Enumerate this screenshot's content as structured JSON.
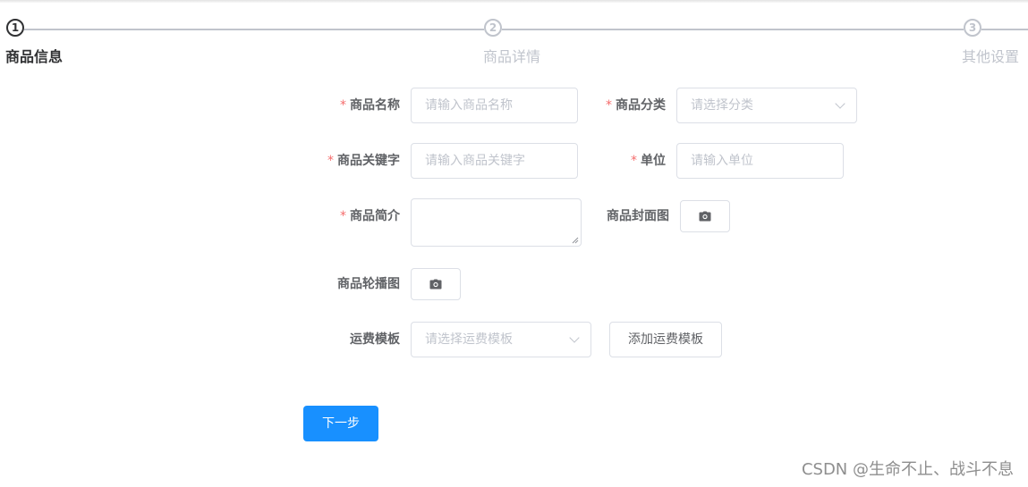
{
  "steps": [
    {
      "number": "1",
      "title": "商品信息",
      "status": "active"
    },
    {
      "number": "2",
      "title": "商品详情",
      "status": "wait"
    },
    {
      "number": "3",
      "title": "其他设置",
      "status": "wait"
    }
  ],
  "form": {
    "required_mark": "*",
    "name": {
      "label": "商品名称",
      "placeholder": "请输入商品名称",
      "value": ""
    },
    "category": {
      "label": "商品分类",
      "placeholder": "请选择分类",
      "value": ""
    },
    "keywords": {
      "label": "商品关键字",
      "placeholder": "请输入商品关键字",
      "value": ""
    },
    "unit": {
      "label": "单位",
      "placeholder": "请输入单位",
      "value": ""
    },
    "intro": {
      "label": "商品简介",
      "value": ""
    },
    "cover": {
      "label": "商品封面图"
    },
    "carousel": {
      "label": "商品轮播图"
    },
    "shipping": {
      "label": "运费模板",
      "placeholder": "请选择运费模板",
      "value": ""
    },
    "add_shipping_label": "添加运费模板"
  },
  "next_button_label": "下一步",
  "watermark": "CSDN @生命不止、战斗不息",
  "colors": {
    "primary": "#1890ff",
    "required": "#f56c6c",
    "active_step": "#303133",
    "inactive_step": "#c0c4cc"
  }
}
